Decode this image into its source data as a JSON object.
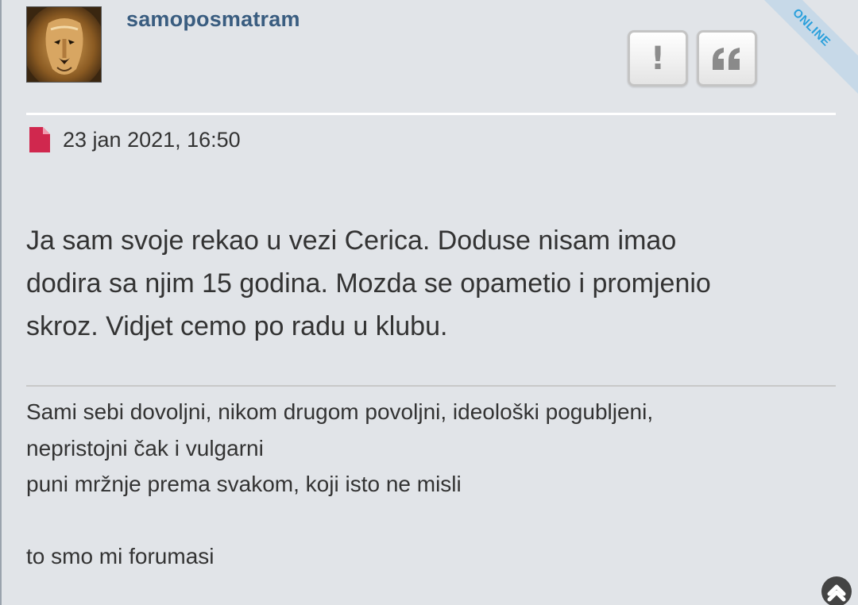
{
  "post": {
    "author": "samoposmatram",
    "status_ribbon": "ONLINE",
    "report_label": "!",
    "date": "23 jan 2021, 16:50",
    "content_lines": [
      "Ja sam svoje rekao u vezi Cerica. Doduse nisam imao",
      "dodira sa njim 15 godina. Mozda se opametio i promjenio",
      "skroz. Vidjet cemo po radu u klubu."
    ],
    "signature_lines": [
      "Sami sebi dovoljni, nikom drugom povoljni, ideološki pogubljeni,",
      "nepristojni čak i vulgarni",
      "puni mržnje prema svakom, koji isto ne misli",
      "",
      "to smo mi forumasi"
    ]
  },
  "icons": {
    "post_icon": "file-icon",
    "quote_icon": "quote-icon",
    "scroll_icon": "chevron-up-icon",
    "avatar": "lion-avatar"
  },
  "colors": {
    "background": "#e1e4e8",
    "username": "#3a5d80",
    "post_icon": "#d0284e",
    "online_text": "#2aa0dc",
    "online_ribbon": "#c7d9e8",
    "text": "#333333"
  }
}
